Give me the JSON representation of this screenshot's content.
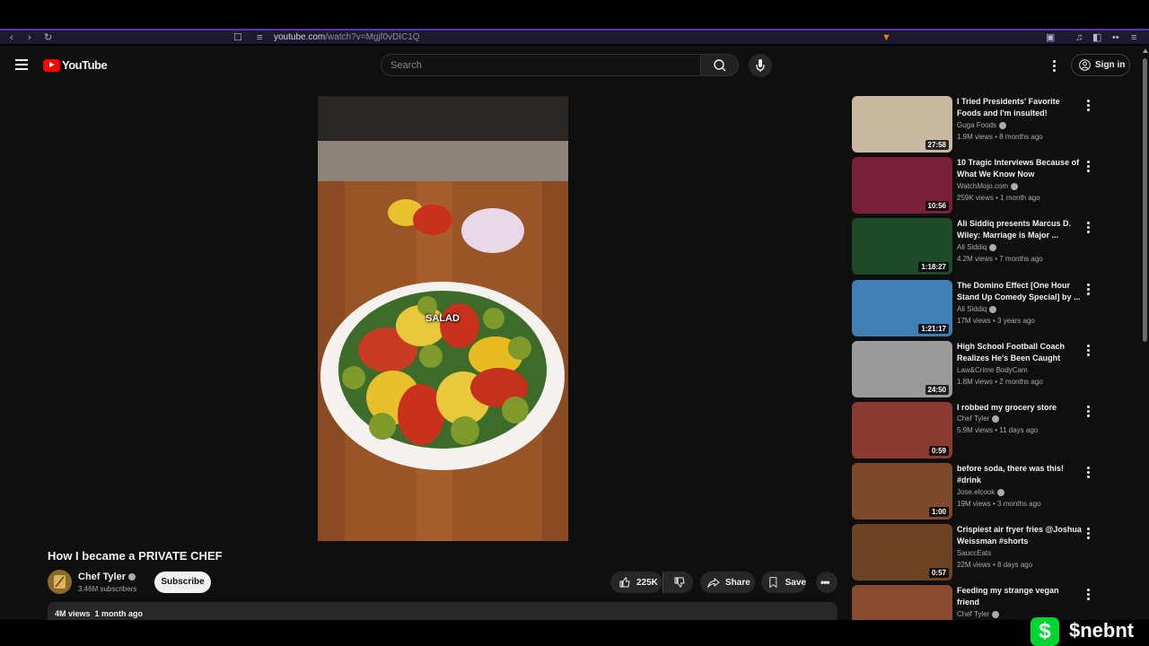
{
  "browser": {
    "url_host": "youtube.com",
    "url_path": "/watch?v=Mgjf0vDIC1Q"
  },
  "masthead": {
    "logo_text": "YouTube",
    "search_placeholder": "Search",
    "signin_label": "Sign in"
  },
  "video": {
    "overlay_text": "SALAD",
    "title": "How I became a PRIVATE CHEF",
    "channel": "Chef Tyler",
    "subscribers": "3.46M subscribers",
    "subscribe_label": "Subscribe",
    "likes": "225K",
    "share_label": "Share",
    "save_label": "Save",
    "views": "4M views",
    "age": "1 month ago"
  },
  "recommendations": [
    {
      "title": "I Tried Presidents' Favorite Foods and I'm insulted!",
      "channel": "Guga Foods",
      "verified": true,
      "meta": "1.9M views • 8 months ago",
      "duration": "27:58",
      "color": "#c9b9a0"
    },
    {
      "title": "10 Tragic Interviews Because of What We Know Now",
      "channel": "WatchMojo.com",
      "verified": true,
      "meta": "259K views • 1 month ago",
      "duration": "10:56",
      "color": "#7a1f3c"
    },
    {
      "title": "Ali Siddiq presents Marcus D. Wiley: Marriage is Major ...",
      "channel": "Ali Siddiq",
      "verified": true,
      "meta": "4.2M views • 7 months ago",
      "duration": "1:18:27",
      "color": "#1e4a2a"
    },
    {
      "title": "The Domino Effect [One Hour Stand Up Comedy Special] by ...",
      "channel": "Ali Siddiq",
      "verified": true,
      "meta": "17M views • 3 years ago",
      "duration": "1:21:17",
      "color": "#3f7fb5"
    },
    {
      "title": "High School Football Coach Realizes He's Been Caught",
      "channel": "Law&Crime BodyCam",
      "verified": false,
      "meta": "1.8M views • 2 months ago",
      "duration": "24:50",
      "color": "#9a9a9a"
    },
    {
      "title": "I robbed my grocery store",
      "channel": "Chef Tyler",
      "verified": true,
      "meta": "5.9M views • 11 days ago",
      "duration": "0:59",
      "color": "#8c3b33"
    },
    {
      "title": "before soda, there was this! #drink",
      "channel": "Jose.elcook",
      "verified": true,
      "meta": "19M views • 3 months ago",
      "duration": "1:00",
      "color": "#7c4a2a"
    },
    {
      "title": "Crispiest air fryer fries @Joshua Weissman #shorts",
      "channel": "SauccEats",
      "verified": false,
      "meta": "22M views • 8 days ago",
      "duration": "0:57",
      "color": "#6e4324"
    },
    {
      "title": "Feeding my strange vegan friend",
      "channel": "Chef Tyler",
      "verified": true,
      "meta": "",
      "duration": "",
      "color": "#8a4a30"
    }
  ],
  "overlay": {
    "cashapp_symbol": "$",
    "cashtag": "$nebnt"
  }
}
